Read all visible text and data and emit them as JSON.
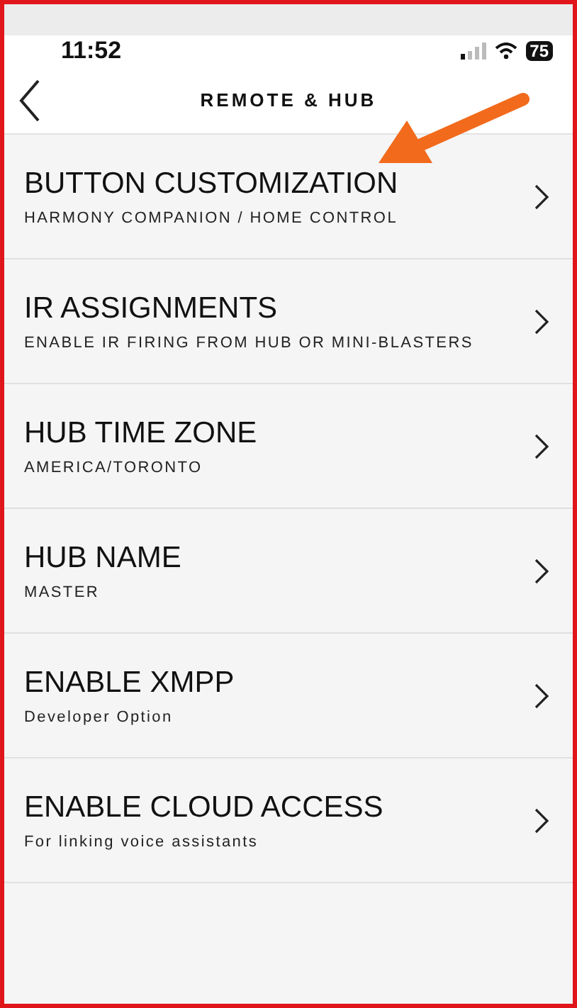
{
  "status_bar": {
    "time": "11:52",
    "battery": "75"
  },
  "header": {
    "title": "REMOTE & HUB"
  },
  "items": [
    {
      "title": "BUTTON CUSTOMIZATION",
      "subtitle": "HARMONY COMPANION / HOME CONTROL"
    },
    {
      "title": "IR ASSIGNMENTS",
      "subtitle": "ENABLE IR FIRING FROM HUB OR MINI-BLASTERS"
    },
    {
      "title": "HUB TIME ZONE",
      "subtitle": "AMERICA/TORONTO"
    },
    {
      "title": "HUB NAME",
      "subtitle": "MASTER"
    },
    {
      "title": "ENABLE XMPP",
      "subtitle": "Developer Option"
    },
    {
      "title": "ENABLE CLOUD ACCESS",
      "subtitle": "For linking voice assistants"
    }
  ]
}
